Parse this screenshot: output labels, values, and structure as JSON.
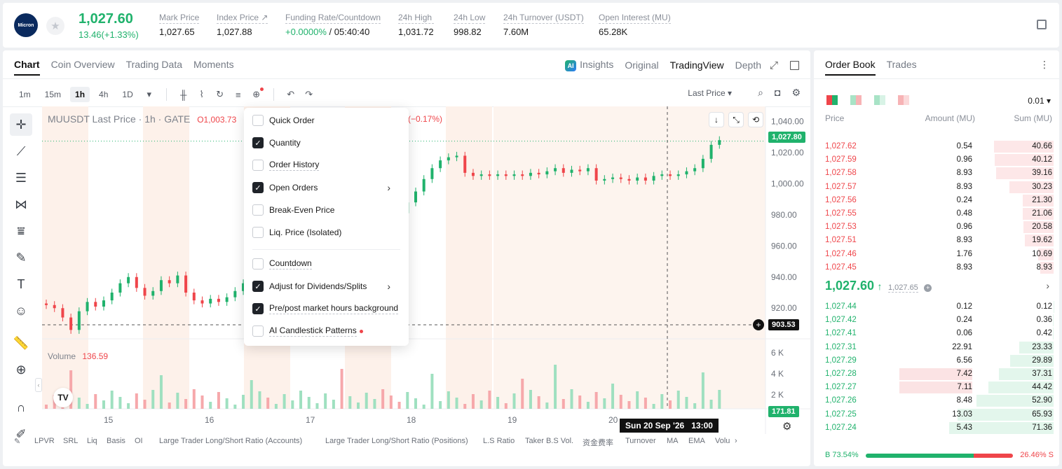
{
  "header": {
    "logo_text": "Micron",
    "price": "1,027.60",
    "change": "13.46(+1.33%)",
    "stats": [
      {
        "label": "Mark Price",
        "value": "1,027.65"
      },
      {
        "label": "Index Price ↗",
        "value": "1,027.88"
      },
      {
        "label": "Funding Rate/Countdown",
        "value_green": "+0.0000%",
        "value": " / 05:40:40"
      },
      {
        "label": "24h High",
        "value": "1,031.72"
      },
      {
        "label": "24h Low",
        "value": "998.82"
      },
      {
        "label": "24h Turnover (USDT)",
        "value": "7.60M"
      },
      {
        "label": "Open Interest (MU)",
        "value": "65.28K"
      }
    ]
  },
  "chart_tabs": {
    "left": [
      "Chart",
      "Coin Overview",
      "Trading Data",
      "Moments"
    ],
    "ai_badge": "AI",
    "right": [
      "Insights",
      "Original",
      "TradingView",
      "Depth"
    ]
  },
  "toolbar": {
    "timeframes": [
      "1m",
      "15m",
      "1h",
      "4h",
      "1D"
    ],
    "active_timeframe": "1h",
    "price_type": "Last Price"
  },
  "chart": {
    "title": "MUUSDT Last Price · 1h · GATE",
    "ohlc_open": "O1,003.73",
    "change_pct": "(−0.17%)",
    "volume_label": "Volume",
    "volume_value": "136.59",
    "last_price_tag": "1,027.80",
    "cursor_price_tag": "903.53",
    "volume_tag": "171.81",
    "crosshair_time": "Sun 20 Sep '26   13:00",
    "logo": "TV"
  },
  "chart_data": {
    "type": "candlestick",
    "y_ticks": [
      "1,040.00",
      "1,020.00",
      "1,000.00",
      "980.00",
      "960.00",
      "940.00",
      "920.00"
    ],
    "ylim": [
      903,
      1047
    ],
    "vol_ticks": [
      "6 K",
      "4 K",
      "2 K"
    ],
    "x_ticks": [
      "15",
      "16",
      "17",
      "18",
      "19",
      "20"
    ],
    "close_series": [
      922,
      920,
      914,
      906,
      918,
      924,
      921,
      925,
      930,
      936,
      940,
      933,
      928,
      931,
      938,
      936,
      941,
      930,
      925,
      923,
      926,
      924,
      927,
      931,
      936,
      940,
      943,
      938,
      944,
      947,
      952,
      958,
      964,
      968,
      972,
      975,
      971,
      978,
      982,
      988,
      994,
      989,
      985,
      981,
      988,
      995,
      1003,
      1010,
      1015,
      1017,
      1018,
      1007,
      1005,
      1006,
      1005,
      1006,
      1005,
      1006,
      1005,
      1007,
      1006,
      1008,
      1010,
      1007,
      1009,
      1008,
      1010,
      1002,
      1003,
      1004,
      1003,
      1002,
      1004,
      1002,
      1005,
      1006,
      1005,
      1006,
      1008,
      1010,
      1016,
      1025,
      1028
    ]
  },
  "bottom_indicators": [
    "LPVR",
    "SRL",
    "Liq",
    "Basis",
    "OI",
    "Large Trader Long/Short Ratio (Accounts)",
    "Large Trader Long/Short Ratio (Positions)",
    "L.S Ratio",
    "Taker B.S Vol.",
    "资金费率",
    "Turnover",
    "MA",
    "EMA",
    "Volu"
  ],
  "settings_menu": {
    "items": [
      {
        "label": "Quick Order",
        "checked": false
      },
      {
        "label": "Quantity",
        "checked": true
      },
      {
        "label": "Order History",
        "checked": false
      },
      {
        "label": "Open Orders",
        "checked": true,
        "submenu": true
      },
      {
        "label": "Break-Even Price",
        "checked": false
      },
      {
        "label": "Liq. Price (Isolated)",
        "checked": false
      },
      {
        "label": "Countdown",
        "checked": false
      },
      {
        "label": "Adjust for Dividends/Splits",
        "checked": true,
        "submenu": true
      },
      {
        "label": "Pre/post market hours background",
        "checked": true
      },
      {
        "label": "AI Candlestick Patterns",
        "checked": false
      }
    ]
  },
  "orderbook": {
    "tabs": [
      "Order Book",
      "Trades"
    ],
    "precision": "0.01",
    "headers": {
      "price": "Price",
      "amount": "Amount (MU)",
      "sum": "Sum (MU)"
    },
    "asks": [
      {
        "price": "1,027.62",
        "amount": "0.54",
        "sum": "40.66"
      },
      {
        "price": "1,027.59",
        "amount": "0.96",
        "sum": "40.12"
      },
      {
        "price": "1,027.58",
        "amount": "8.93",
        "sum": "39.16"
      },
      {
        "price": "1,027.57",
        "amount": "8.93",
        "sum": "30.23"
      },
      {
        "price": "1,027.56",
        "amount": "0.24",
        "sum": "21.30"
      },
      {
        "price": "1,027.55",
        "amount": "0.48",
        "sum": "21.06"
      },
      {
        "price": "1,027.53",
        "amount": "0.96",
        "sum": "20.58"
      },
      {
        "price": "1,027.51",
        "amount": "8.93",
        "sum": "19.62"
      },
      {
        "price": "1,027.46",
        "amount": "1.76",
        "sum": "10.69"
      },
      {
        "price": "1,027.45",
        "amount": "8.93",
        "sum": "8.93"
      }
    ],
    "last_price": "1,027.60",
    "mark_price": "1,027.65",
    "bids": [
      {
        "price": "1,027.44",
        "amount": "0.12",
        "sum": "0.12"
      },
      {
        "price": "1,027.42",
        "amount": "0.24",
        "sum": "0.36"
      },
      {
        "price": "1,027.41",
        "amount": "0.06",
        "sum": "0.42"
      },
      {
        "price": "1,027.31",
        "amount": "22.91",
        "sum": "23.33"
      },
      {
        "price": "1,027.29",
        "amount": "6.56",
        "sum": "29.89"
      },
      {
        "price": "1,027.28",
        "amount": "7.42",
        "sum": "37.31"
      },
      {
        "price": "1,027.27",
        "amount": "7.11",
        "sum": "44.42"
      },
      {
        "price": "1,027.26",
        "amount": "8.48",
        "sum": "52.90"
      },
      {
        "price": "1,027.25",
        "amount": "13.03",
        "sum": "65.93"
      },
      {
        "price": "1,027.24",
        "amount": "5.43",
        "sum": "71.36"
      }
    ],
    "buy_ratio": "B 73.54%",
    "sell_ratio": "26.46% S",
    "buy_fraction": 0.7354
  },
  "colors": {
    "up": "#20b26c",
    "down": "#ef454a",
    "session_shade": "#fdf1ea"
  }
}
